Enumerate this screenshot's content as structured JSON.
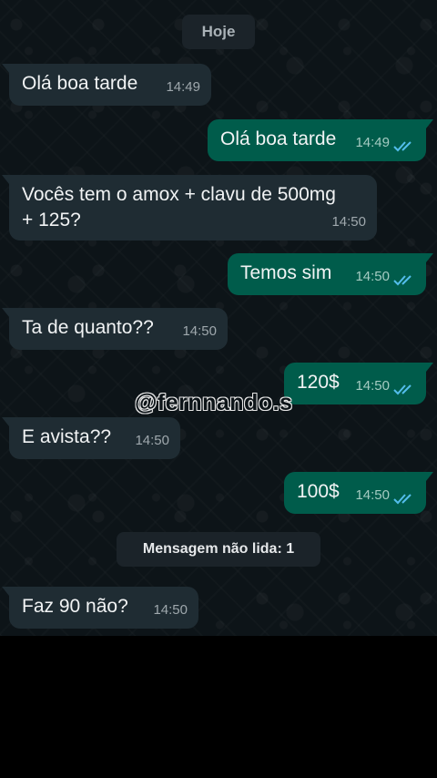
{
  "date_divider": "Hoje",
  "unread_divider": "Mensagem não lida: 1",
  "watermark": "@fernnando.s",
  "colors": {
    "background": "#0d1418",
    "incoming_bubble": "#1f2c33",
    "outgoing_bubble": "#005c4b",
    "read_ticks": "#53bdeb"
  },
  "messages": [
    {
      "direction": "incoming",
      "text": "Olá boa tarde",
      "time": "14:49"
    },
    {
      "direction": "outgoing",
      "text": "Olá boa tarde",
      "time": "14:49",
      "status": "read"
    },
    {
      "direction": "incoming",
      "text": "Vocês tem o amox + clavu de 500mg\n+ 125?",
      "time": "14:50"
    },
    {
      "direction": "outgoing",
      "text": "Temos sim",
      "time": "14:50",
      "status": "read"
    },
    {
      "direction": "incoming",
      "text": "Ta de quanto??",
      "time": "14:50"
    },
    {
      "direction": "outgoing",
      "text": "120$",
      "time": "14:50",
      "status": "read"
    },
    {
      "direction": "incoming",
      "text": "E avista??",
      "time": "14:50"
    },
    {
      "direction": "outgoing",
      "text": "100$",
      "time": "14:50",
      "status": "read"
    },
    {
      "direction": "incoming",
      "text": "Faz 90 não?",
      "time": "14:50"
    }
  ]
}
